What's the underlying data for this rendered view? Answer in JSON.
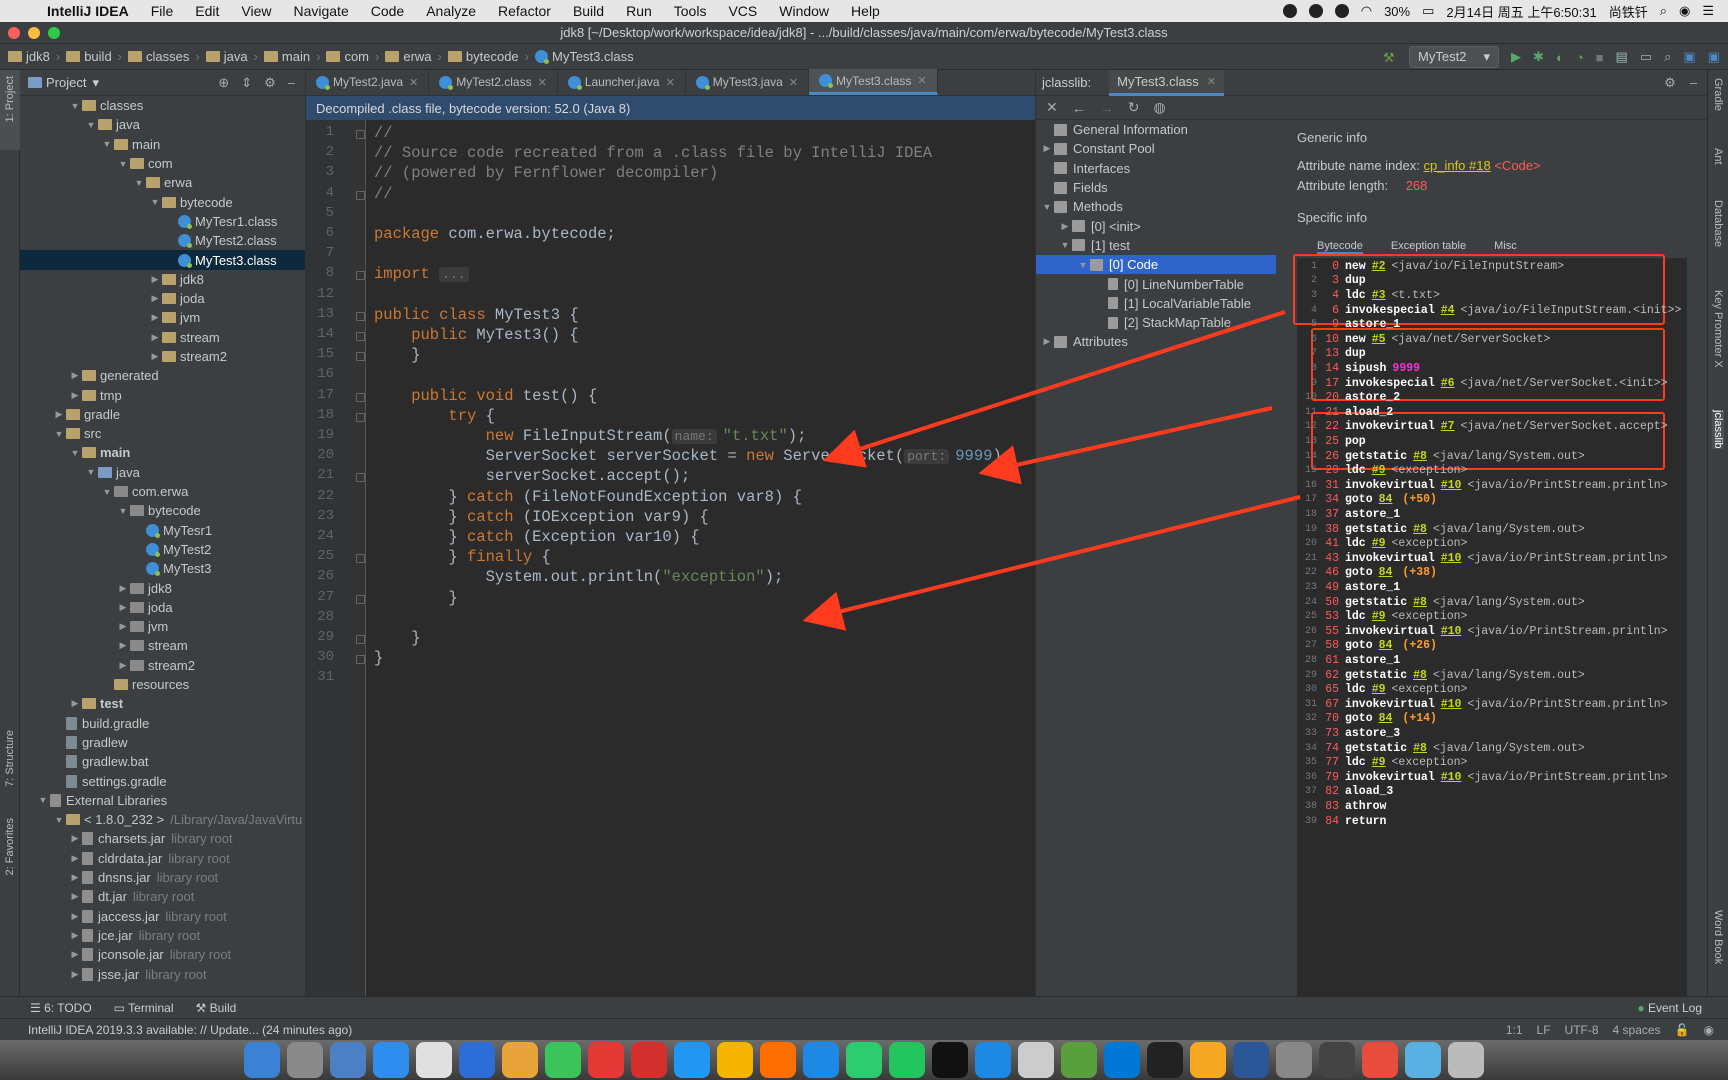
{
  "menubar": {
    "items": [
      "IntelliJ IDEA",
      "File",
      "Edit",
      "View",
      "Navigate",
      "Code",
      "Analyze",
      "Refactor",
      "Build",
      "Run",
      "Tools",
      "VCS",
      "Window",
      "Help"
    ],
    "battery": "30%",
    "datetime": "2月14日 周五 上午6:50:31",
    "user": "尚铁钎"
  },
  "titlebar": {
    "title": "jdk8 [~/Desktop/work/workspace/idea/jdk8] - .../build/classes/java/main/com/erwa/bytecode/MyTest3.class"
  },
  "breadcrumbs": [
    "jdk8",
    "build",
    "classes",
    "java",
    "main",
    "com",
    "erwa",
    "bytecode",
    "MyTest3.class"
  ],
  "run_config": {
    "name": "MyTest2"
  },
  "project_panel": {
    "title": "Project",
    "tree": [
      {
        "label": "classes",
        "depth": 2,
        "arrow": "down",
        "icon": "folder"
      },
      {
        "label": "java",
        "depth": 3,
        "arrow": "down",
        "icon": "folder"
      },
      {
        "label": "main",
        "depth": 4,
        "arrow": "down",
        "icon": "folder"
      },
      {
        "label": "com",
        "depth": 5,
        "arrow": "down",
        "icon": "folder"
      },
      {
        "label": "erwa",
        "depth": 6,
        "arrow": "down",
        "icon": "folder"
      },
      {
        "label": "bytecode",
        "depth": 7,
        "arrow": "down",
        "icon": "folder"
      },
      {
        "label": "MyTesr1.class",
        "depth": 8,
        "arrow": "",
        "icon": "class"
      },
      {
        "label": "MyTest2.class",
        "depth": 8,
        "arrow": "",
        "icon": "class"
      },
      {
        "label": "MyTest3.class",
        "depth": 8,
        "arrow": "",
        "icon": "class",
        "selected": true
      },
      {
        "label": "jdk8",
        "depth": 7,
        "arrow": "right",
        "icon": "folder"
      },
      {
        "label": "joda",
        "depth": 7,
        "arrow": "right",
        "icon": "folder"
      },
      {
        "label": "jvm",
        "depth": 7,
        "arrow": "right",
        "icon": "folder"
      },
      {
        "label": "stream",
        "depth": 7,
        "arrow": "right",
        "icon": "folder"
      },
      {
        "label": "stream2",
        "depth": 7,
        "arrow": "right",
        "icon": "folder"
      },
      {
        "label": "generated",
        "depth": 2,
        "arrow": "right",
        "icon": "folder"
      },
      {
        "label": "tmp",
        "depth": 2,
        "arrow": "right",
        "icon": "folder"
      },
      {
        "label": "gradle",
        "depth": 1,
        "arrow": "right",
        "icon": "folder"
      },
      {
        "label": "src",
        "depth": 1,
        "arrow": "down",
        "icon": "folder"
      },
      {
        "label": "main",
        "depth": 2,
        "arrow": "down",
        "icon": "folder",
        "bold": true
      },
      {
        "label": "java",
        "depth": 3,
        "arrow": "down",
        "icon": "folder-blue"
      },
      {
        "label": "com.erwa",
        "depth": 4,
        "arrow": "down",
        "icon": "package"
      },
      {
        "label": "bytecode",
        "depth": 5,
        "arrow": "down",
        "icon": "package"
      },
      {
        "label": "MyTesr1",
        "depth": 6,
        "arrow": "",
        "icon": "class"
      },
      {
        "label": "MyTest2",
        "depth": 6,
        "arrow": "",
        "icon": "class"
      },
      {
        "label": "MyTest3",
        "depth": 6,
        "arrow": "",
        "icon": "class"
      },
      {
        "label": "jdk8",
        "depth": 5,
        "arrow": "right",
        "icon": "package"
      },
      {
        "label": "joda",
        "depth": 5,
        "arrow": "right",
        "icon": "package"
      },
      {
        "label": "jvm",
        "depth": 5,
        "arrow": "right",
        "icon": "package"
      },
      {
        "label": "stream",
        "depth": 5,
        "arrow": "right",
        "icon": "package"
      },
      {
        "label": "stream2",
        "depth": 5,
        "arrow": "right",
        "icon": "package"
      },
      {
        "label": "resources",
        "depth": 4,
        "arrow": "",
        "icon": "folder"
      },
      {
        "label": "test",
        "depth": 2,
        "arrow": "right",
        "icon": "folder",
        "bold": true
      },
      {
        "label": "build.gradle",
        "depth": 1,
        "arrow": "",
        "icon": "file"
      },
      {
        "label": "gradlew",
        "depth": 1,
        "arrow": "",
        "icon": "file"
      },
      {
        "label": "gradlew.bat",
        "depth": 1,
        "arrow": "",
        "icon": "file"
      },
      {
        "label": "settings.gradle",
        "depth": 1,
        "arrow": "",
        "icon": "file"
      },
      {
        "label": "External Libraries",
        "depth": 0,
        "arrow": "down",
        "icon": "lib"
      },
      {
        "label": "< 1.8.0_232 >",
        "suffix": "/Library/Java/JavaVirtu",
        "depth": 1,
        "arrow": "down",
        "icon": "folder"
      },
      {
        "label": "charsets.jar",
        "suffix": "library root",
        "depth": 2,
        "arrow": "right",
        "icon": "jar"
      },
      {
        "label": "cldrdata.jar",
        "suffix": "library root",
        "depth": 2,
        "arrow": "right",
        "icon": "jar"
      },
      {
        "label": "dnsns.jar",
        "suffix": "library root",
        "depth": 2,
        "arrow": "right",
        "icon": "jar"
      },
      {
        "label": "dt.jar",
        "suffix": "library root",
        "depth": 2,
        "arrow": "right",
        "icon": "jar"
      },
      {
        "label": "jaccess.jar",
        "suffix": "library root",
        "depth": 2,
        "arrow": "right",
        "icon": "jar"
      },
      {
        "label": "jce.jar",
        "suffix": "library root",
        "depth": 2,
        "arrow": "right",
        "icon": "jar"
      },
      {
        "label": "jconsole.jar",
        "suffix": "library root",
        "depth": 2,
        "arrow": "right",
        "icon": "jar"
      },
      {
        "label": "jsse.jar",
        "suffix": "library root",
        "depth": 2,
        "arrow": "right",
        "icon": "jar"
      }
    ]
  },
  "editor": {
    "tabs": [
      {
        "label": "MyTest2.java",
        "active": false
      },
      {
        "label": "MyTest2.class",
        "active": false
      },
      {
        "label": "Launcher.java",
        "active": false
      },
      {
        "label": "MyTest3.java",
        "active": false
      },
      {
        "label": "MyTest3.class",
        "active": true
      }
    ],
    "banner": "Decompiled .class file, bytecode version: 52.0 (Java 8)",
    "lines": [
      [
        {
          "t": "//",
          "c": "cm"
        }
      ],
      [
        {
          "t": "// Source code recreated from a .class file by IntelliJ IDEA",
          "c": "cm"
        }
      ],
      [
        {
          "t": "// (powered by Fernflower decompiler)",
          "c": "cm"
        }
      ],
      [
        {
          "t": "//",
          "c": "cm"
        }
      ],
      [],
      [
        {
          "t": "package ",
          "c": "kw"
        },
        {
          "t": "com.erwa.bytecode;",
          "c": ""
        }
      ],
      [],
      [
        {
          "t": "import ",
          "c": "kw"
        },
        {
          "t": "...",
          "c": "hint"
        }
      ],
      [],
      [
        {
          "t": "public class ",
          "c": "kw"
        },
        {
          "t": "MyTest3 {",
          "c": ""
        }
      ],
      [
        {
          "t": "    public ",
          "c": "kw"
        },
        {
          "t": "MyTest3() {",
          "c": ""
        }
      ],
      [
        {
          "t": "    }",
          "c": ""
        }
      ],
      [],
      [
        {
          "t": "    public void ",
          "c": "kw"
        },
        {
          "t": "test() {",
          "c": ""
        }
      ],
      [
        {
          "t": "        try ",
          "c": "kw"
        },
        {
          "t": "{",
          "c": ""
        }
      ],
      [
        {
          "t": "            new ",
          "c": "kw"
        },
        {
          "t": "FileInputStream(",
          "c": ""
        },
        {
          "t": "name:",
          "c": "hint"
        },
        {
          "t": "\"t.txt\"",
          "c": "st"
        },
        {
          "t": ");",
          "c": ""
        }
      ],
      [
        {
          "t": "            ServerSocket serverSocket = ",
          "c": ""
        },
        {
          "t": "new ",
          "c": "kw"
        },
        {
          "t": "ServerSocket(",
          "c": ""
        },
        {
          "t": "port:",
          "c": "hint"
        },
        {
          "t": "9999",
          "c": "nm"
        },
        {
          "t": ");",
          "c": ""
        }
      ],
      [
        {
          "t": "            serverSocket.accept();",
          "c": ""
        }
      ],
      [
        {
          "t": "        } ",
          "c": ""
        },
        {
          "t": "catch ",
          "c": "kw"
        },
        {
          "t": "(FileNotFoundException var8) {",
          "c": ""
        }
      ],
      [
        {
          "t": "        } ",
          "c": ""
        },
        {
          "t": "catch ",
          "c": "kw"
        },
        {
          "t": "(IOException var9) {",
          "c": ""
        }
      ],
      [
        {
          "t": "        } ",
          "c": ""
        },
        {
          "t": "catch ",
          "c": "kw"
        },
        {
          "t": "(Exception var10) {",
          "c": ""
        }
      ],
      [
        {
          "t": "        } ",
          "c": ""
        },
        {
          "t": "finally ",
          "c": "kw"
        },
        {
          "t": "{",
          "c": ""
        }
      ],
      [
        {
          "t": "            System.",
          "c": ""
        },
        {
          "t": "out",
          "c": ""
        },
        {
          "t": ".println(",
          "c": ""
        },
        {
          "t": "\"exception\"",
          "c": "st"
        },
        {
          "t": ");",
          "c": ""
        }
      ],
      [
        {
          "t": "        }",
          "c": ""
        }
      ],
      [],
      [
        {
          "t": "    }",
          "c": ""
        }
      ],
      [
        {
          "t": "}",
          "c": ""
        }
      ],
      []
    ],
    "line_numbers": [
      "1",
      "2",
      "3",
      "4",
      "5",
      "6",
      "7",
      "8",
      "12",
      "13",
      "14",
      "15",
      "16",
      "17",
      "18",
      "19",
      "20",
      "21",
      "22",
      "23",
      "24",
      "25",
      "26",
      "27",
      "28",
      "29",
      "30",
      "31"
    ]
  },
  "jclasslib": {
    "label": "jclasslib:",
    "tab": "MyTest3.class",
    "tree": [
      {
        "label": "General Information",
        "depth": 0,
        "arrow": ""
      },
      {
        "label": "Constant Pool",
        "depth": 0,
        "arrow": "right"
      },
      {
        "label": "Interfaces",
        "depth": 0,
        "arrow": ""
      },
      {
        "label": "Fields",
        "depth": 0,
        "arrow": ""
      },
      {
        "label": "Methods",
        "depth": 0,
        "arrow": "down"
      },
      {
        "label": "[0] <init>",
        "depth": 1,
        "arrow": "right"
      },
      {
        "label": "[1] test",
        "depth": 1,
        "arrow": "down"
      },
      {
        "label": "[0] Code",
        "depth": 2,
        "arrow": "down",
        "selected": true
      },
      {
        "label": "[0] LineNumberTable",
        "depth": 3,
        "arrow": ""
      },
      {
        "label": "[1] LocalVariableTable",
        "depth": 3,
        "arrow": ""
      },
      {
        "label": "[2] StackMapTable",
        "depth": 3,
        "arrow": ""
      },
      {
        "label": "Attributes",
        "depth": 0,
        "arrow": "right"
      }
    ],
    "generic_info": "Generic info",
    "attr_name_label": "Attribute name index:",
    "attr_name_link": "cp_info #18",
    "attr_name_value": "<Code>",
    "attr_len_label": "Attribute length:",
    "attr_len_value": "268",
    "specific_info": "Specific info",
    "subtabs": [
      "Bytecode",
      "Exception table",
      "Misc"
    ],
    "bytecode": [
      {
        "n": "1",
        "o": "0",
        "op": "new",
        "ref": "#2",
        "cm": "<java/io/FileInputStream>"
      },
      {
        "n": "2",
        "o": "3",
        "op": "dup"
      },
      {
        "n": "3",
        "o": "4",
        "op": "ldc",
        "ref": "#3",
        "cm": "<t.txt>"
      },
      {
        "n": "4",
        "o": "6",
        "op": "invokespecial",
        "ref": "#4",
        "cm": "<java/io/FileInputStream.<init>>"
      },
      {
        "n": "5",
        "o": "9",
        "op": "astore_1"
      },
      {
        "n": "6",
        "o": "10",
        "op": "new",
        "ref": "#5",
        "cm": "<java/net/ServerSocket>"
      },
      {
        "n": "7",
        "o": "13",
        "op": "dup"
      },
      {
        "n": "8",
        "o": "14",
        "op": "sipush",
        "num": "9999"
      },
      {
        "n": "9",
        "o": "17",
        "op": "invokespecial",
        "ref": "#6",
        "cm": "<java/net/ServerSocket.<init>>"
      },
      {
        "n": "10",
        "o": "20",
        "op": "astore_2"
      },
      {
        "n": "11",
        "o": "21",
        "op": "aload_2"
      },
      {
        "n": "12",
        "o": "22",
        "op": "invokevirtual",
        "ref": "#7",
        "cm": "<java/net/ServerSocket.accept>"
      },
      {
        "n": "13",
        "o": "25",
        "op": "pop"
      },
      {
        "n": "14",
        "o": "26",
        "op": "getstatic",
        "ref": "#8",
        "cm": "<java/lang/System.out>"
      },
      {
        "n": "15",
        "o": "29",
        "op": "ldc",
        "ref": "#9",
        "cm": "<exception>"
      },
      {
        "n": "16",
        "o": "31",
        "op": "invokevirtual",
        "ref": "#10",
        "cm": "<java/io/PrintStream.println>"
      },
      {
        "n": "17",
        "o": "34",
        "op": "goto",
        "ref": "84",
        "jmp": "(+50)"
      },
      {
        "n": "18",
        "o": "37",
        "op": "astore_1"
      },
      {
        "n": "19",
        "o": "38",
        "op": "getstatic",
        "ref": "#8",
        "cm": "<java/lang/System.out>"
      },
      {
        "n": "20",
        "o": "41",
        "op": "ldc",
        "ref": "#9",
        "cm": "<exception>"
      },
      {
        "n": "21",
        "o": "43",
        "op": "invokevirtual",
        "ref": "#10",
        "cm": "<java/io/PrintStream.println>"
      },
      {
        "n": "22",
        "o": "46",
        "op": "goto",
        "ref": "84",
        "jmp": "(+38)"
      },
      {
        "n": "23",
        "o": "49",
        "op": "astore_1"
      },
      {
        "n": "24",
        "o": "50",
        "op": "getstatic",
        "ref": "#8",
        "cm": "<java/lang/System.out>"
      },
      {
        "n": "25",
        "o": "53",
        "op": "ldc",
        "ref": "#9",
        "cm": "<exception>"
      },
      {
        "n": "26",
        "o": "55",
        "op": "invokevirtual",
        "ref": "#10",
        "cm": "<java/io/PrintStream.println>"
      },
      {
        "n": "27",
        "o": "58",
        "op": "goto",
        "ref": "84",
        "jmp": "(+26)"
      },
      {
        "n": "28",
        "o": "61",
        "op": "astore_1"
      },
      {
        "n": "29",
        "o": "62",
        "op": "getstatic",
        "ref": "#8",
        "cm": "<java/lang/System.out>"
      },
      {
        "n": "30",
        "o": "65",
        "op": "ldc",
        "ref": "#9",
        "cm": "<exception>"
      },
      {
        "n": "31",
        "o": "67",
        "op": "invokevirtual",
        "ref": "#10",
        "cm": "<java/io/PrintStream.println>"
      },
      {
        "n": "32",
        "o": "70",
        "op": "goto",
        "ref": "84",
        "jmp": "(+14)"
      },
      {
        "n": "33",
        "o": "73",
        "op": "astore_3"
      },
      {
        "n": "34",
        "o": "74",
        "op": "getstatic",
        "ref": "#8",
        "cm": "<java/lang/System.out>"
      },
      {
        "n": "35",
        "o": "77",
        "op": "ldc",
        "ref": "#9",
        "cm": "<exception>"
      },
      {
        "n": "36",
        "o": "79",
        "op": "invokevirtual",
        "ref": "#10",
        "cm": "<java/io/PrintStream.println>"
      },
      {
        "n": "37",
        "o": "82",
        "op": "aload_3"
      },
      {
        "n": "38",
        "o": "83",
        "op": "athrow"
      },
      {
        "n": "39",
        "o": "84",
        "op": "return"
      }
    ]
  },
  "left_stripe": [
    "1: Project",
    "7: Structure",
    "2: Favorites"
  ],
  "right_stripe": [
    "Gradle",
    "Ant",
    "Database",
    "Key Promoter X",
    "jclasslib",
    "Word Book"
  ],
  "bottom_tools": [
    "6: TODO",
    "Terminal",
    "Build"
  ],
  "event_log": "Event Log",
  "status": {
    "message": "IntelliJ IDEA 2019.3.3 available: // Update... (24 minutes ago)",
    "position": "1:1",
    "line_sep": "LF",
    "encoding": "UTF-8",
    "indent": "4 spaces"
  },
  "colors": {
    "accent": "#4a88c7",
    "annotation": "#ff3b1f",
    "selection": "#2f65ca"
  }
}
